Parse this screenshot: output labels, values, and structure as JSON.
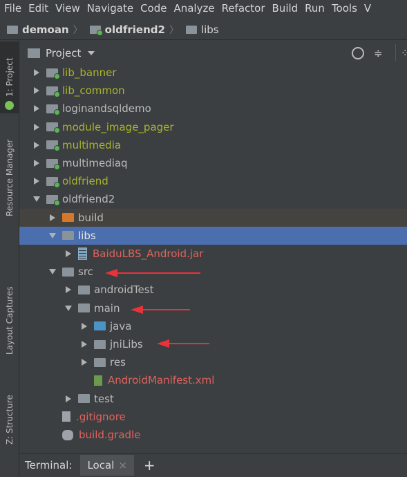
{
  "menu": [
    "File",
    "Edit",
    "View",
    "Navigate",
    "Code",
    "Analyze",
    "Refactor",
    "Build",
    "Run",
    "Tools",
    "V"
  ],
  "breadcrumb": [
    "demoan",
    "oldfriend2",
    "libs"
  ],
  "sidebar_tabs": [
    "1: Project",
    "Resource Manager",
    "Layout Captures",
    "Z: Structure"
  ],
  "panel": {
    "title": "Project"
  },
  "tree": [
    {
      "label": "lib_banner",
      "color": "green",
      "open": false,
      "icon": "module",
      "indent": 0
    },
    {
      "label": "lib_common",
      "color": "green",
      "open": false,
      "icon": "module",
      "indent": 0
    },
    {
      "label": "loginandsqldemo",
      "color": "gray",
      "open": false,
      "icon": "module",
      "indent": 0
    },
    {
      "label": "module_image_pager",
      "color": "green",
      "open": false,
      "icon": "module",
      "indent": 0
    },
    {
      "label": "multimedia",
      "color": "green",
      "open": false,
      "icon": "module",
      "indent": 0
    },
    {
      "label": "multimediaq",
      "color": "gray",
      "open": false,
      "icon": "module",
      "indent": 0
    },
    {
      "label": "oldfriend",
      "color": "green",
      "open": false,
      "icon": "module",
      "indent": 0
    },
    {
      "label": "oldfriend2",
      "color": "gray",
      "open": true,
      "icon": "module",
      "indent": 0
    },
    {
      "label": "build",
      "color": "gray",
      "open": false,
      "icon": "folder-orange",
      "indent": 1
    },
    {
      "label": "libs",
      "color": "gray",
      "open": true,
      "icon": "folder",
      "indent": 1,
      "selected": true
    },
    {
      "label": "BaiduLBS_Android.jar",
      "color": "red",
      "open": false,
      "icon": "jar",
      "indent": 2
    },
    {
      "label": "src",
      "color": "gray",
      "open": true,
      "icon": "folder",
      "indent": 1
    },
    {
      "label": "androidTest",
      "color": "gray",
      "open": false,
      "icon": "folder",
      "indent": 2
    },
    {
      "label": "main",
      "color": "gray",
      "open": true,
      "icon": "folder",
      "indent": 2
    },
    {
      "label": "java",
      "color": "gray",
      "open": false,
      "icon": "folder-blue",
      "indent": 3
    },
    {
      "label": "jniLibs",
      "color": "gray",
      "open": false,
      "icon": "folder",
      "indent": 3
    },
    {
      "label": "res",
      "color": "gray",
      "open": false,
      "icon": "folder",
      "indent": 3
    },
    {
      "label": "AndroidManifest.xml",
      "color": "red",
      "open": null,
      "icon": "manifest",
      "indent": 3
    },
    {
      "label": "test",
      "color": "gray",
      "open": false,
      "icon": "folder",
      "indent": 2
    },
    {
      "label": ".gitignore",
      "color": "red",
      "open": null,
      "icon": "file",
      "indent": 1
    },
    {
      "label": "build.gradle",
      "color": "red",
      "open": null,
      "icon": "gradle",
      "indent": 1
    }
  ],
  "terminal": {
    "label": "Terminal:",
    "tab": "Local",
    "close": "×",
    "add": "+"
  }
}
